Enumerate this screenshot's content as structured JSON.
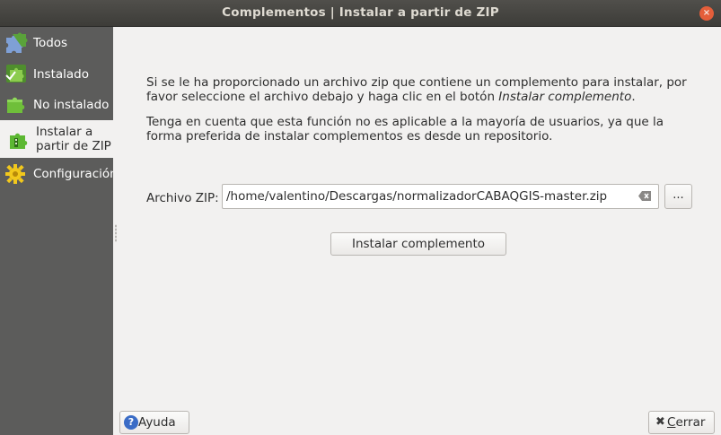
{
  "window": {
    "title": "Complementos | Instalar a partir de ZIP",
    "close_glyph": "×"
  },
  "sidebar": {
    "items": [
      {
        "label": "Todos",
        "icon": "puzzle-all-icon"
      },
      {
        "label": "Instalado",
        "icon": "puzzle-installed-icon"
      },
      {
        "label": "No instalado",
        "icon": "puzzle-not-installed-icon"
      },
      {
        "label": "Instalar a partir de ZIP",
        "icon": "puzzle-zip-icon",
        "selected": true
      },
      {
        "label": "Configuración",
        "icon": "gear-icon"
      }
    ]
  },
  "main": {
    "paragraph1_part1": "Si se le ha proporcionado un archivo zip que contiene un complemento para instalar, por favor seleccione el archivo debajo y haga clic en el botón ",
    "paragraph1_emph": "Instalar complemento",
    "paragraph1_end": ".",
    "paragraph2": "Tenga en cuenta que esta función no es aplicable a la mayoría de usuarios, ya que la forma preferida de instalar complementos es desde un repositorio.",
    "zip_label": "Archivo ZIP:",
    "zip_path": "/home/valentino/Descargas/normalizadorCABAQGIS-master.zip",
    "browse_label": "...",
    "install_button": "Instalar complemento"
  },
  "footer": {
    "help_label": "Ayuda",
    "close_label_underlined": "C",
    "close_label_rest": "errar"
  },
  "colors": {
    "sidebar_bg": "#5c5c5b",
    "content_bg": "#f2f1f0",
    "titlebar_bg": "#3d3c38",
    "close_btn": "#e45e3a",
    "help_icon": "#3a6cc6"
  }
}
